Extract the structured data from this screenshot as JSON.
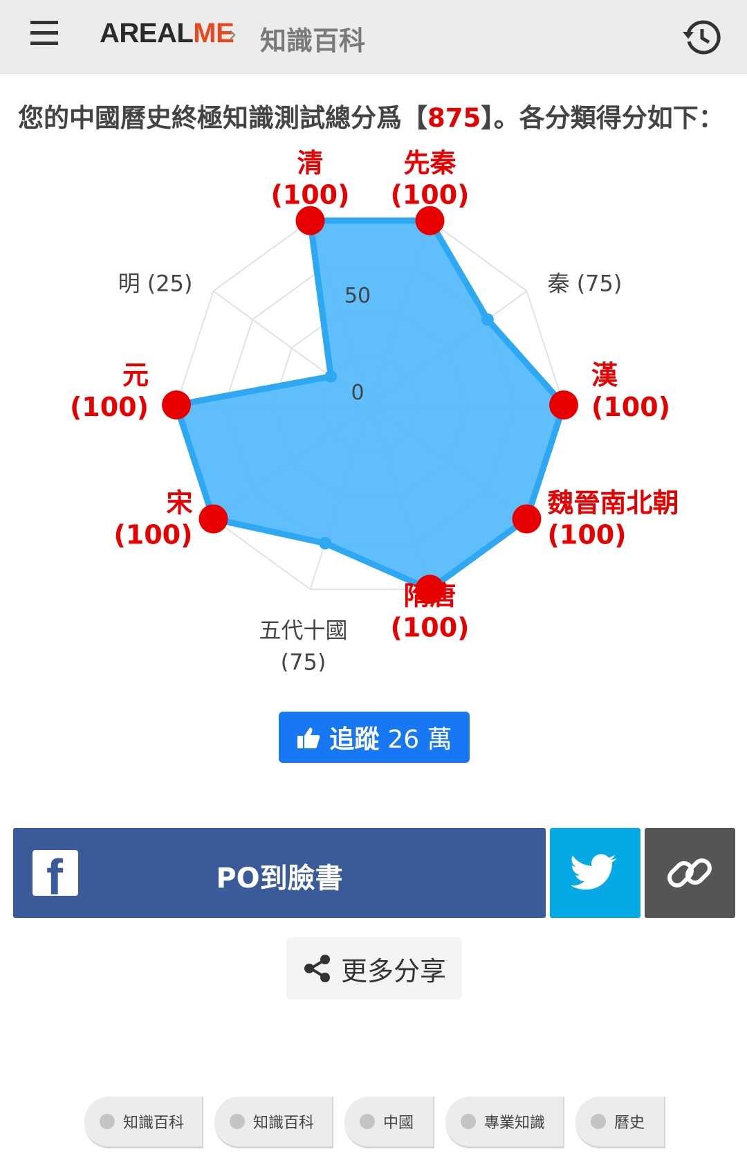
{
  "header": {
    "brand_a": "AREAL",
    "brand_b": "ME",
    "separator": "›",
    "crumb": "知識百科",
    "icons": {
      "menu": "menu-icon",
      "history": "history-icon"
    }
  },
  "headline": {
    "prefix": "您的中國曆史終極知識測試總分爲【",
    "score": "875",
    "suffix": "】。各分類得分如下："
  },
  "chart_data": {
    "type": "radar",
    "categories": [
      "先秦",
      "秦",
      "漢",
      "魏晉南北朝",
      "隋唐",
      "五代十國",
      "宋",
      "元",
      "明",
      "清"
    ],
    "values": [
      100,
      75,
      100,
      100,
      100,
      75,
      100,
      100,
      25,
      100
    ],
    "scale_ticks": [
      "0",
      "50"
    ],
    "rmax": 100,
    "highlight_rule": "score == 100 shown in red bold with red marker",
    "colors": {
      "fill": "#5bbdfa",
      "stroke": "#2ea8f2",
      "highlight": "#e80000",
      "normal_label": "#444444",
      "grid": "#e2e2e2"
    }
  },
  "follow": {
    "label": "追蹤",
    "count": "26 萬"
  },
  "share": {
    "facebook_label": "PO到臉書",
    "more_label": "更多分享",
    "icons": {
      "facebook": "facebook-icon",
      "twitter": "twitter-icon",
      "link": "link-icon",
      "share": "share-icon"
    }
  },
  "tags": [
    "知識百科",
    "知識百科",
    "中國",
    "專業知識",
    "曆史"
  ]
}
